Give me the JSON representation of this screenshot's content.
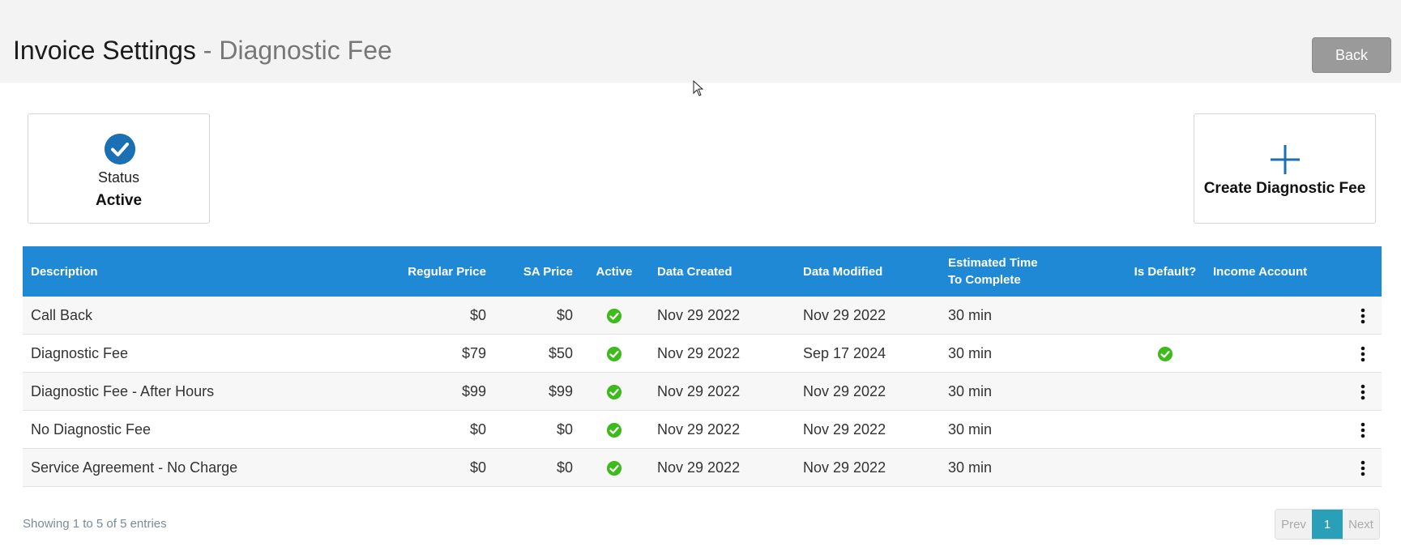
{
  "header": {
    "title": "Invoice Settings",
    "subtitle": " - Diagnostic Fee",
    "back_label": "Back"
  },
  "status_card": {
    "icon": "check-circle-icon",
    "label": "Status",
    "value": "Active"
  },
  "create_card": {
    "icon": "plus-icon",
    "label": "Create Diagnostic Fee"
  },
  "table": {
    "columns": {
      "description": "Description",
      "regular_price": "Regular Price",
      "sa_price": "SA Price",
      "active": "Active",
      "date_created": "Data Created",
      "date_modified": "Data Modified",
      "estimated_time_line1": "Estimated Time",
      "estimated_time_line2": "To Complete",
      "is_default": "Is Default?",
      "income_account": "Income Account"
    },
    "rows": [
      {
        "description": "Call Back",
        "regular_price": "$0",
        "sa_price": "$0",
        "active": true,
        "date_created": "Nov 29 2022",
        "date_modified": "Nov 29 2022",
        "estimated_time": "30 min",
        "is_default": false,
        "income_account": ""
      },
      {
        "description": "Diagnostic Fee",
        "regular_price": "$79",
        "sa_price": "$50",
        "active": true,
        "date_created": "Nov 29 2022",
        "date_modified": "Sep 17 2024",
        "estimated_time": "30 min",
        "is_default": true,
        "income_account": ""
      },
      {
        "description": "Diagnostic Fee - After Hours",
        "regular_price": "$99",
        "sa_price": "$99",
        "active": true,
        "date_created": "Nov 29 2022",
        "date_modified": "Nov 29 2022",
        "estimated_time": "30 min",
        "is_default": false,
        "income_account": ""
      },
      {
        "description": "No Diagnostic Fee",
        "regular_price": "$0",
        "sa_price": "$0",
        "active": true,
        "date_created": "Nov 29 2022",
        "date_modified": "Nov 29 2022",
        "estimated_time": "30 min",
        "is_default": false,
        "income_account": ""
      },
      {
        "description": "Service Agreement - No Charge",
        "regular_price": "$0",
        "sa_price": "$0",
        "active": true,
        "date_created": "Nov 29 2022",
        "date_modified": "Nov 29 2022",
        "estimated_time": "30 min",
        "is_default": false,
        "income_account": ""
      }
    ]
  },
  "footer": {
    "entries_info": "Showing 1 to 5 of 5 entries",
    "prev_label": "Prev",
    "current_page": "1",
    "next_label": "Next"
  },
  "colors": {
    "header_bg": "#f3f3f3",
    "table_header": "#2089d6",
    "active_check": "#3dbb1c",
    "status_icon": "#1b6fb3",
    "page_current": "#2aa0b8"
  }
}
